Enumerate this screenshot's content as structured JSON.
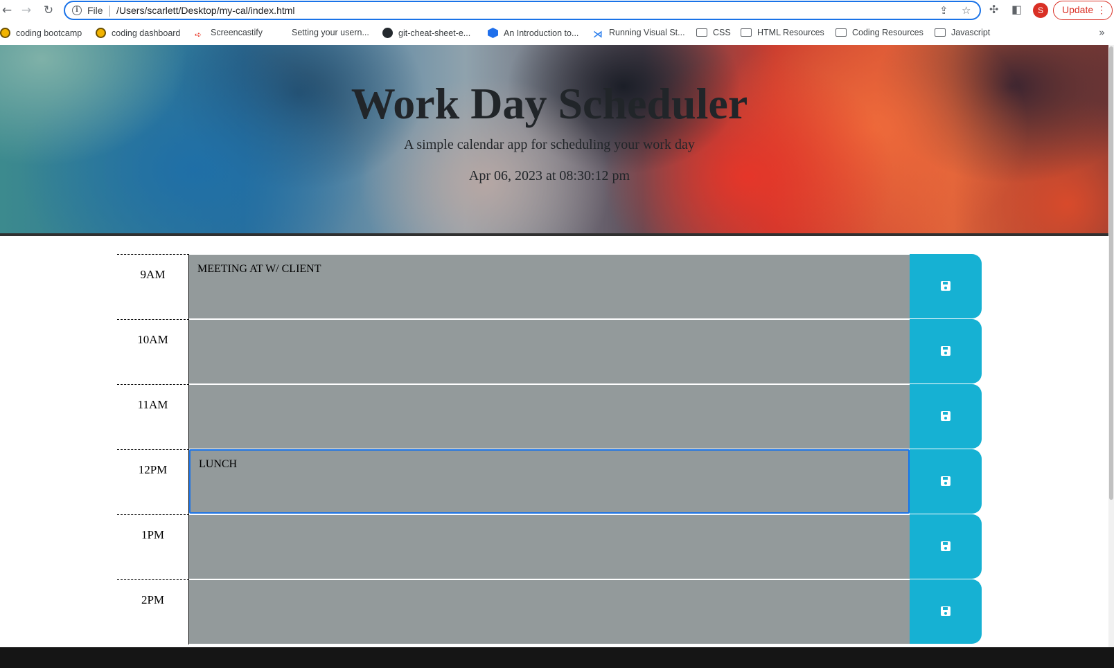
{
  "browser": {
    "omnibox": {
      "scheme_label": "File",
      "url": "/Users/scarlett/Desktop/my-cal/index.html"
    },
    "profile_initial": "S",
    "update_label": "Update",
    "bookmarks": [
      {
        "label": "coding bootcamp",
        "icon": "coin-icon"
      },
      {
        "label": "coding dashboard",
        "icon": "coin-icon"
      },
      {
        "label": "Screencastify",
        "icon": "screencastify-icon"
      },
      {
        "label": "Setting your usern...",
        "icon": "none"
      },
      {
        "label": "git-cheat-sheet-e...",
        "icon": "github-icon"
      },
      {
        "label": "An Introduction to...",
        "icon": "play-icon"
      },
      {
        "label": "Running Visual St...",
        "icon": "vscode-icon"
      },
      {
        "label": "CSS",
        "icon": "folder-icon"
      },
      {
        "label": "HTML Resources",
        "icon": "folder-icon"
      },
      {
        "label": "Coding Resources",
        "icon": "folder-icon"
      },
      {
        "label": "Javascript",
        "icon": "folder-icon"
      }
    ]
  },
  "header": {
    "title": "Work Day Scheduler",
    "lead": "A simple calendar app for scheduling your work day",
    "current_day": "Apr 06, 2023 at 08:30:12 pm"
  },
  "schedule": [
    {
      "hour": "9AM",
      "text": "MEETING AT W/ CLIENT"
    },
    {
      "hour": "10AM",
      "text": ""
    },
    {
      "hour": "11AM",
      "text": ""
    },
    {
      "hour": "12PM",
      "text": "LUNCH"
    },
    {
      "hour": "1PM",
      "text": ""
    },
    {
      "hour": "2PM",
      "text": ""
    }
  ],
  "colors": {
    "past_block": "#939a9b",
    "save_button": "#16b1d3",
    "focus_ring": "#1a73e8",
    "update_accent": "#d93025"
  }
}
